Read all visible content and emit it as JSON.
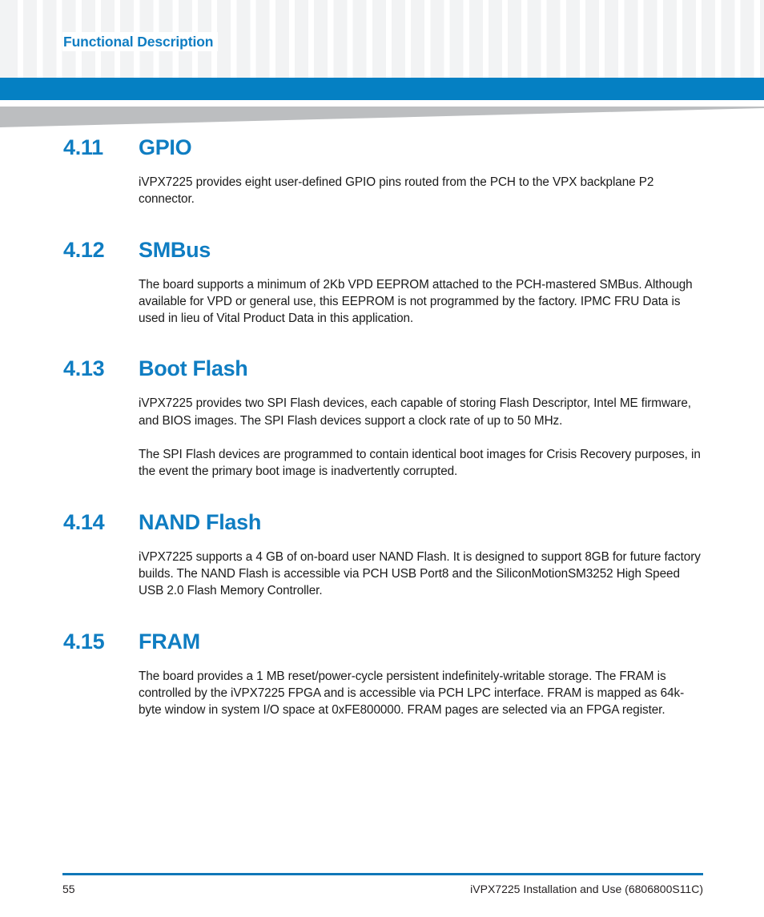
{
  "header": {
    "title": "Functional Description",
    "accent_color": "#0580c3",
    "title_color": "#0f7dc2",
    "wedge_color": "#bcbec0",
    "pattern_color": "#f2f3f4"
  },
  "sections": [
    {
      "number": "4.11",
      "title": "GPIO",
      "paragraphs": [
        "iVPX7225 provides eight user-defined GPIO pins routed from the PCH to the VPX backplane P2 connector."
      ]
    },
    {
      "number": "4.12",
      "title": "SMBus",
      "paragraphs": [
        "The board supports a minimum of 2Kb VPD EEPROM attached to the PCH-mastered SMBus. Although available for VPD or general use, this EEPROM is not programmed by the factory. IPMC FRU Data is used in lieu of Vital Product Data in this application."
      ]
    },
    {
      "number": "4.13",
      "title": "Boot Flash",
      "paragraphs": [
        "iVPX7225 provides two SPI Flash devices, each capable of storing Flash Descriptor, Intel ME firmware, and BIOS images. The SPI Flash devices support a clock rate of up to 50 MHz.",
        "The SPI Flash devices are programmed to contain identical boot images for Crisis Recovery purposes, in the event the primary boot image is inadvertently corrupted."
      ]
    },
    {
      "number": "4.14",
      "title": "NAND Flash",
      "paragraphs": [
        "iVPX7225 supports a 4 GB of on-board user NAND Flash. It is designed to support 8GB for future factory builds. The NAND Flash is accessible via PCH USB Port8 and the SiliconMotionSM3252 High Speed USB 2.0 Flash Memory Controller."
      ]
    },
    {
      "number": "4.15",
      "title": "FRAM",
      "paragraphs": [
        "The board provides a 1 MB reset/power-cycle persistent indefinitely-writable storage. The FRAM is controlled by the iVPX7225 FPGA and is accessible via PCH LPC interface. FRAM is mapped as 64k-byte window in system I/O space at 0xFE800000. FRAM pages are selected via an FPGA register."
      ]
    }
  ],
  "footer": {
    "page_number": "55",
    "document_title": "iVPX7225 Installation and Use (6806800S11C)",
    "rule_color": "#1077b8"
  }
}
